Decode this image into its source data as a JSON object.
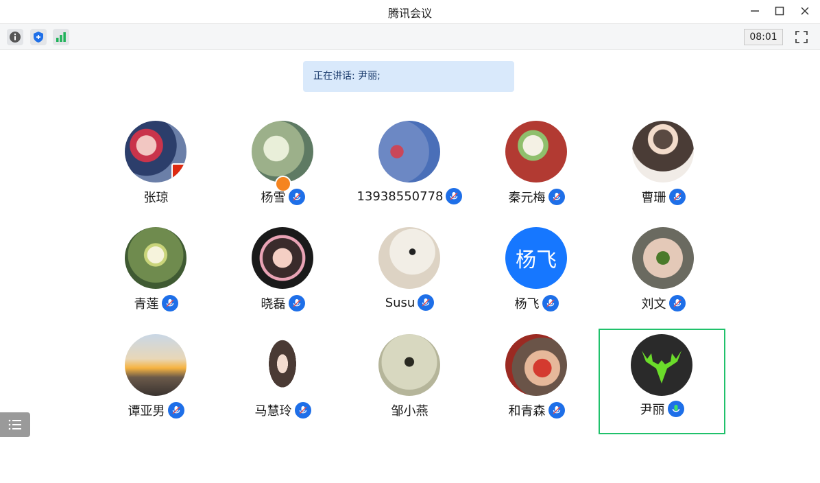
{
  "window": {
    "title": "腾讯会议"
  },
  "toolbar": {
    "timer": "08:01"
  },
  "speaking": {
    "text": "正在讲话: 尹丽;"
  },
  "participants": [
    {
      "name": "张琼",
      "mic": false
    },
    {
      "name": "杨雪",
      "mic": true
    },
    {
      "name": "13938550778",
      "mic": true
    },
    {
      "name": "秦元梅",
      "mic": true
    },
    {
      "name": "曹珊",
      "mic": true
    },
    {
      "name": "青莲",
      "mic": true
    },
    {
      "name": "晓磊",
      "mic": true
    },
    {
      "name": "Susu",
      "mic": true
    },
    {
      "name": "杨飞",
      "mic": true,
      "avatar_text": "杨飞"
    },
    {
      "name": "刘文",
      "mic": true
    },
    {
      "name": "谭亚男",
      "mic": true
    },
    {
      "name": "马慧玲",
      "mic": true
    },
    {
      "name": "邹小燕",
      "mic": false
    },
    {
      "name": "和青森",
      "mic": true
    },
    {
      "name": "尹丽",
      "mic": true,
      "speaking": true
    }
  ],
  "colors": {
    "accent": "#1e6fe8",
    "speaking_border": "#20c16b",
    "banner": "#d9e9fb"
  }
}
